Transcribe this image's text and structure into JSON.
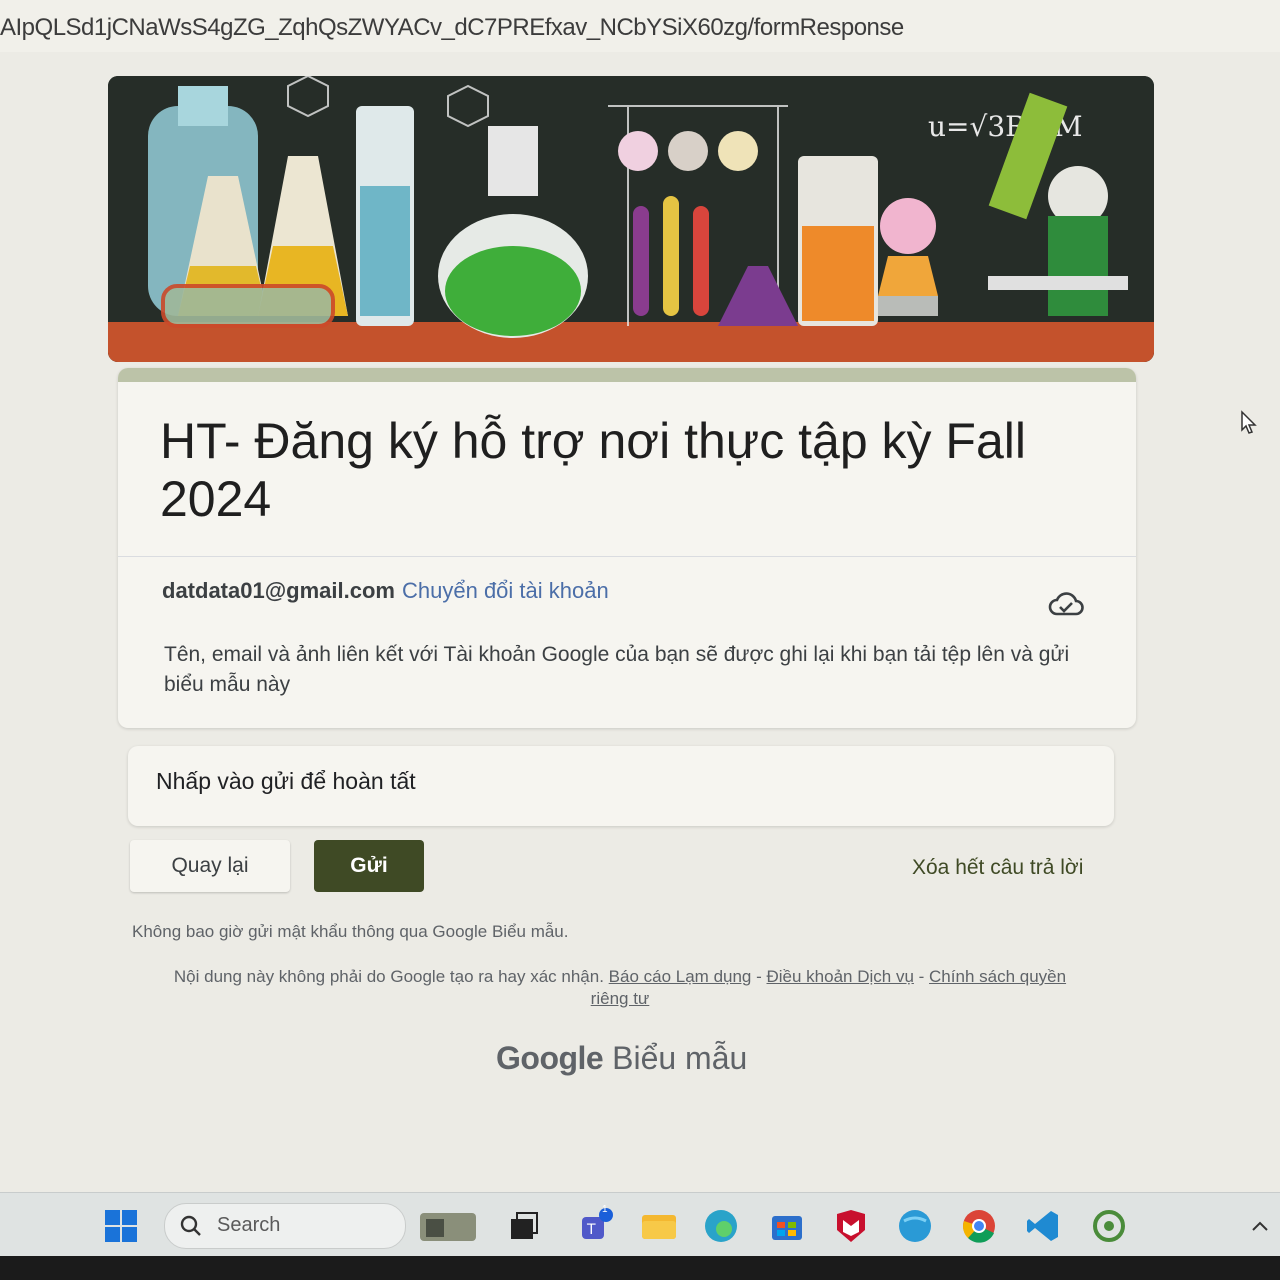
{
  "browser": {
    "url": "AIpQLSd1jCNaWsS4gZG_ZqhQsZWYACv_dC7PREfxav_NCbYSiX60zg/formResponse"
  },
  "form": {
    "title": "HT- Đăng ký hỗ trợ nơi thực tập kỳ Fall 2024",
    "account_email": "datdata01@gmail.com",
    "switch_account_label": "Chuyển đổi tài khoản",
    "notice": "Tên, email và ảnh liên kết với Tài khoản Google của bạn sẽ được ghi lại khi bạn tải tệp lên và gửi biểu mẫu này",
    "submit_prompt": "Nhấp vào gửi để hoàn tất",
    "back_label": "Quay lại",
    "send_label": "Gửi",
    "clear_label": "Xóa hết câu trả lời",
    "no_password_warning": "Không bao giờ gửi mật khẩu thông qua Google Biểu mẫu.",
    "disclaimer_text": "Nội dung này không phải do Google tạo ra hay xác nhận.",
    "report_abuse": "Báo cáo Lạm dụng",
    "terms": "Điều khoản Dịch vụ",
    "privacy": "Chính sách quyền riêng tư",
    "separator": " - ",
    "brand_google": "Google",
    "brand_forms": "Biểu mẫu"
  },
  "taskbar": {
    "search_label": "Search",
    "teams_badge": "1"
  },
  "colors": {
    "accent": "#3f4a25",
    "title_bar": "#bcc3a8",
    "link": "#4b6ea8"
  }
}
